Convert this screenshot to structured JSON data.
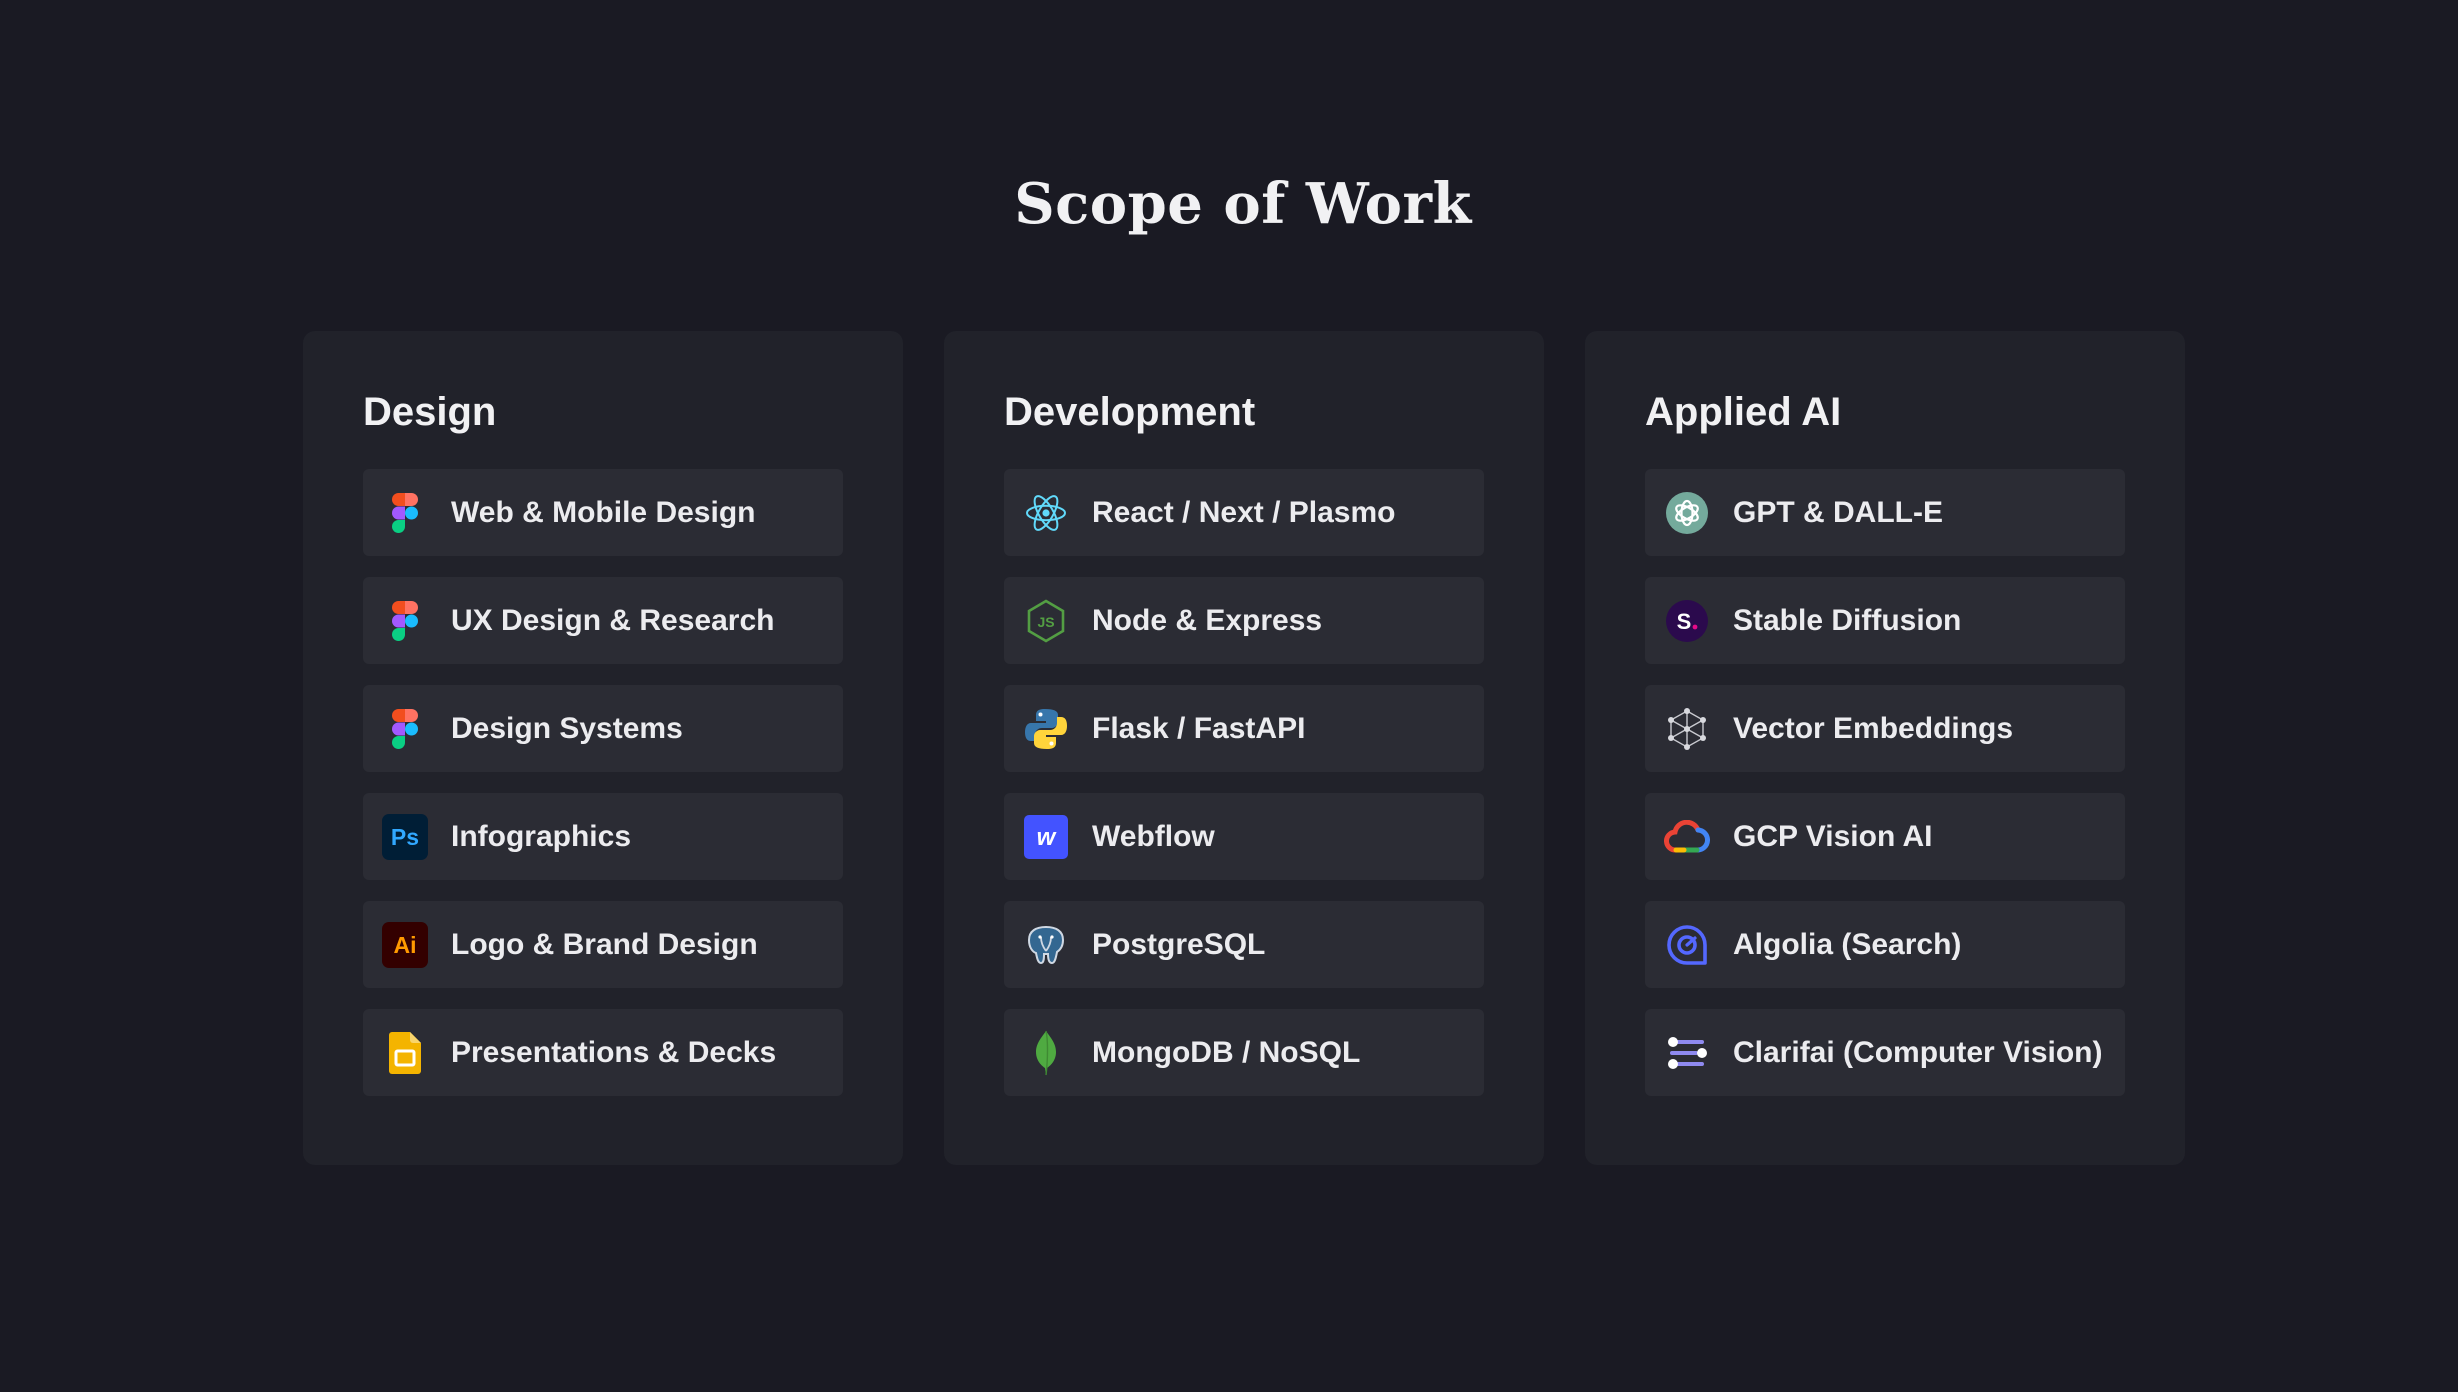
{
  "page": {
    "title": "Scope of Work"
  },
  "columns": [
    {
      "title": "Design",
      "items": [
        {
          "label": "Web & Mobile Design",
          "icon": "figma-icon"
        },
        {
          "label": "UX Design & Research",
          "icon": "figma-icon"
        },
        {
          "label": "Design Systems",
          "icon": "figma-icon"
        },
        {
          "label": "Infographics",
          "icon": "photoshop-icon"
        },
        {
          "label": "Logo & Brand Design",
          "icon": "illustrator-icon"
        },
        {
          "label": "Presentations & Decks",
          "icon": "google-slides-icon"
        }
      ]
    },
    {
      "title": "Development",
      "items": [
        {
          "label": "React / Next / Plasmo",
          "icon": "react-icon"
        },
        {
          "label": "Node & Express",
          "icon": "nodejs-icon"
        },
        {
          "label": "Flask / FastAPI",
          "icon": "python-icon"
        },
        {
          "label": "Webflow",
          "icon": "webflow-icon"
        },
        {
          "label": "PostgreSQL",
          "icon": "postgresql-icon"
        },
        {
          "label": "MongoDB / NoSQL",
          "icon": "mongodb-icon"
        }
      ]
    },
    {
      "title": "Applied AI",
      "items": [
        {
          "label": "GPT & DALL-E",
          "icon": "openai-icon"
        },
        {
          "label": "Stable Diffusion",
          "icon": "stability-ai-icon"
        },
        {
          "label": "Vector Embeddings",
          "icon": "vector-embeddings-icon"
        },
        {
          "label": "GCP Vision AI",
          "icon": "google-cloud-icon"
        },
        {
          "label": "Algolia (Search)",
          "icon": "algolia-icon"
        },
        {
          "label": "Clarifai (Computer Vision)",
          "icon": "clarifai-icon"
        }
      ]
    }
  ],
  "icon_text": {
    "photoshop": "Ps",
    "illustrator": "Ai",
    "webflow": "w",
    "stability": "S",
    "nodejs": "JS"
  },
  "colors": {
    "background": "#1a1a23",
    "card": "#21222a",
    "item": "#2b2c34",
    "text": "#ececef"
  }
}
